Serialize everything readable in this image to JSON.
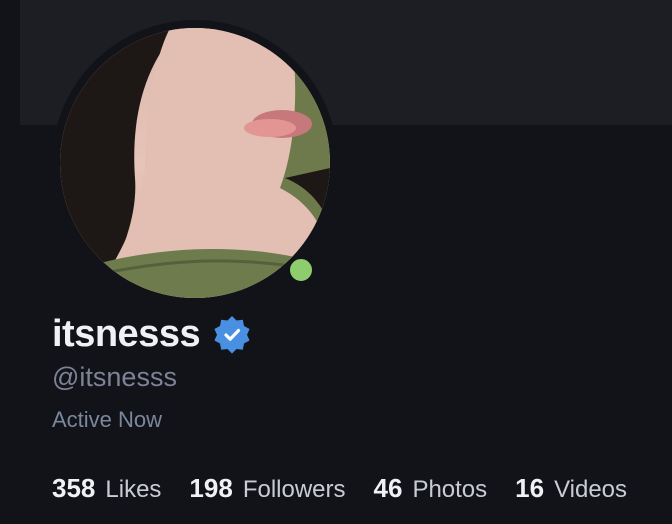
{
  "profile": {
    "display_name": "itsnesss",
    "handle": "@itsnesss",
    "status": "Active Now",
    "verified": true,
    "online": true,
    "online_color": "#8dcd6e",
    "verified_color": "#4a90e2"
  },
  "stats": [
    {
      "count": "358",
      "label": "Likes"
    },
    {
      "count": "198",
      "label": "Followers"
    },
    {
      "count": "46",
      "label": "Photos"
    },
    {
      "count": "16",
      "label": "Videos"
    }
  ],
  "icons": {
    "verified": "verified-badge-icon",
    "online": "online-status-icon"
  }
}
